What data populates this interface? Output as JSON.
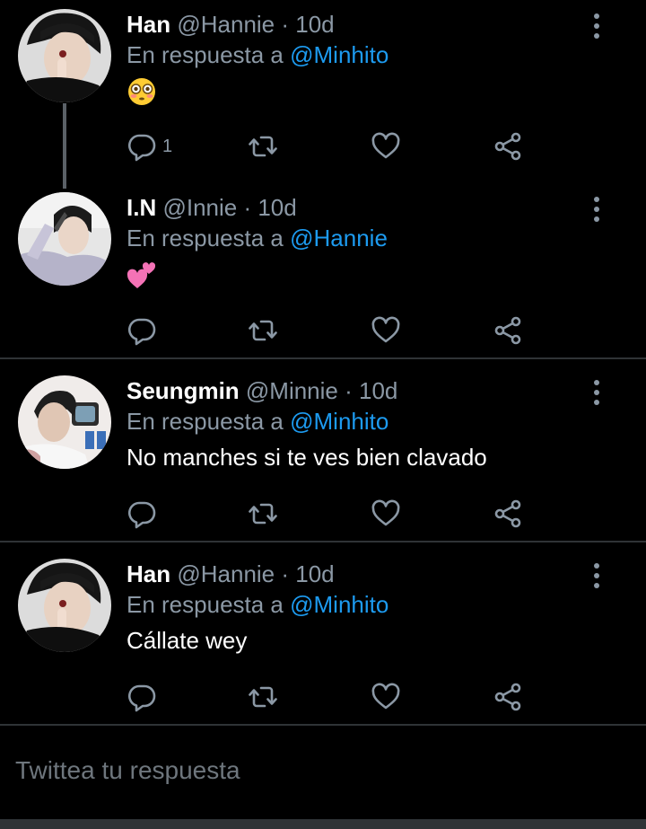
{
  "tweets": [
    {
      "name": "Han",
      "meta": " @Hannie · 10d",
      "reply_prefix": "En respuesta a ",
      "reply_to": "@Minhito",
      "emoji": "flushed-face-emoji",
      "reply_count": "1"
    },
    {
      "name": "I.N",
      "meta": " @Innie · 10d",
      "reply_prefix": "En respuesta a ",
      "reply_to": "@Hannie",
      "emoji": "two-hearts-emoji",
      "reply_count": ""
    },
    {
      "name": "Seungmin",
      "meta": " @Minnie · 10d",
      "reply_prefix": "En respuesta a ",
      "reply_to": "@Minhito",
      "text": "No manches si te ves bien clavado",
      "reply_count": ""
    },
    {
      "name": "Han",
      "meta": " @Hannie · 10d",
      "reply_prefix": "En respuesta a ",
      "reply_to": "@Minhito",
      "text": "Cállate wey",
      "reply_count": ""
    }
  ],
  "composer": {
    "placeholder": "Twittea tu respuesta"
  },
  "colors": {
    "background": "#000000",
    "link": "#1d9bf0",
    "muted": "#8b98a5",
    "divider": "#2f3336"
  },
  "icons": [
    "more-vertical-icon",
    "reply-icon",
    "retweet-icon",
    "like-icon",
    "share-icon"
  ]
}
